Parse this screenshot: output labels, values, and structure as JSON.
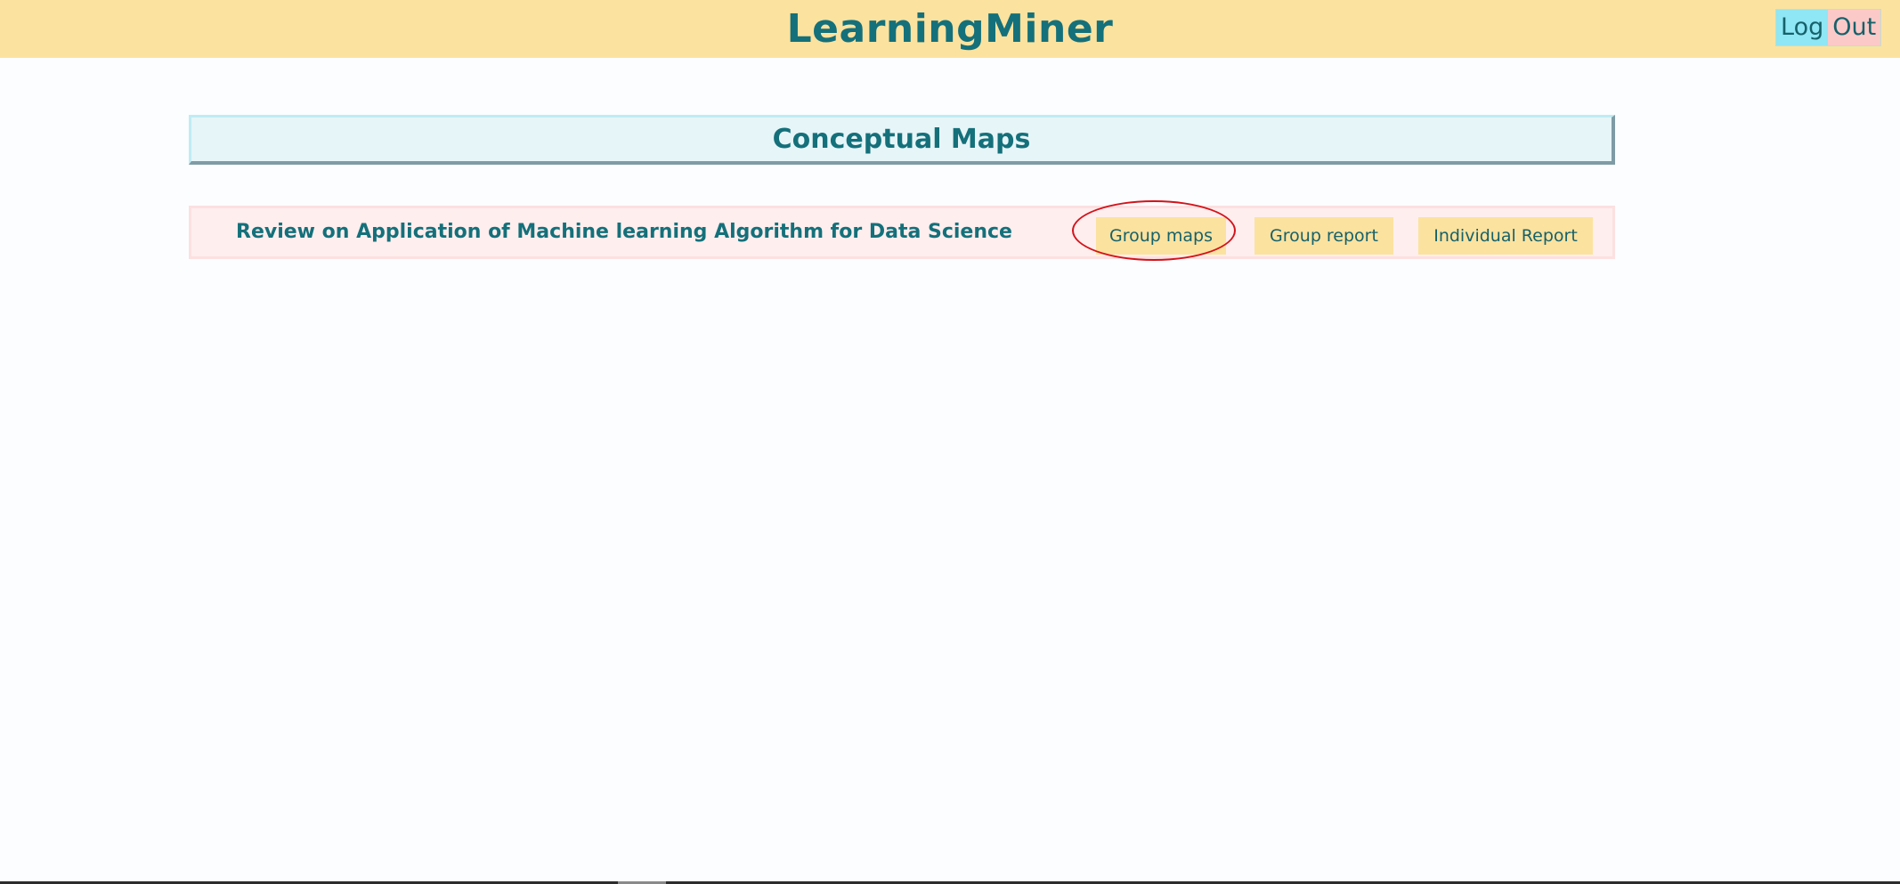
{
  "header": {
    "app_title": "LearningMiner",
    "logout": {
      "log_label": "Log",
      "out_label": "Out"
    }
  },
  "main": {
    "section_title": "Conceptual Maps",
    "maps": [
      {
        "title": "Review on Application of Machine learning Algorithm for Data Science",
        "buttons": {
          "group_maps": "Group maps",
          "group_report": "Group report",
          "individual_report": "Individual Report"
        }
      }
    ]
  },
  "colors": {
    "header_bg": "#fce29f",
    "brand_text": "#14707a",
    "section_header_bg": "#e6f5f8",
    "row_bg": "#feeeee",
    "button_bg": "#fce29f",
    "highlight_ring": "#d2141c"
  }
}
